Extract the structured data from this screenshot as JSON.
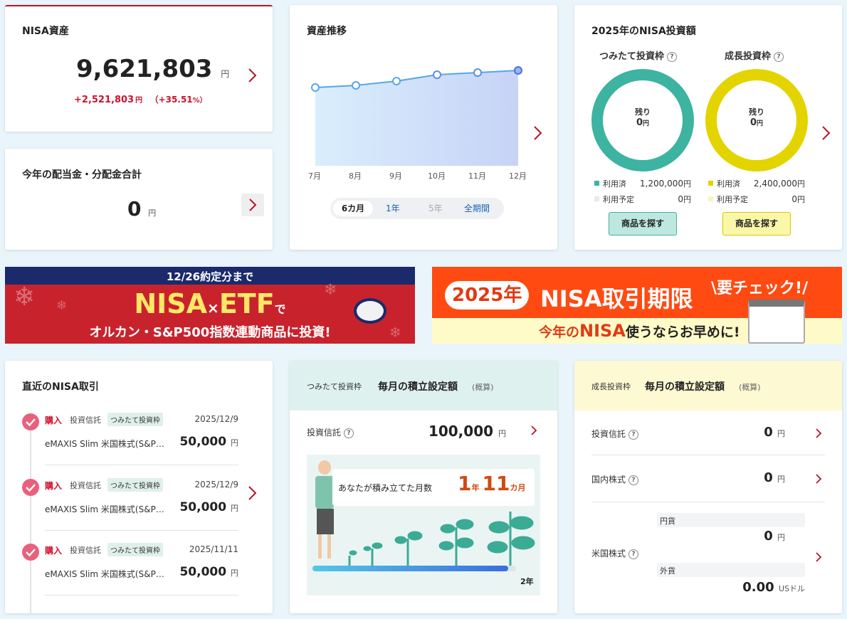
{
  "assets": {
    "title": "NISA資産",
    "value": "9,621,803",
    "unit": "円",
    "gain": "+2,521,803",
    "gain_unit": "円",
    "pct": "（+35.51",
    "pct_unit": "%）"
  },
  "dividend": {
    "title": "今年の配当金・分配金合計",
    "value": "0",
    "unit": "円"
  },
  "trend": {
    "title": "資産推移",
    "months": [
      "7月",
      "8月",
      "9月",
      "10月",
      "11月",
      "12月"
    ],
    "ranges": [
      "6カ月",
      "1年",
      "5年",
      "全期間"
    ]
  },
  "invest2025": {
    "title": "2025年のNISA投資額",
    "tsumitate": {
      "label": "つみたて投資枠",
      "remain_label": "残り",
      "remain": "0",
      "remain_unit": "円",
      "used_label": "利用済",
      "used": "1,200,000",
      "used_unit": "円",
      "plan_label": "利用予定",
      "plan": "0",
      "plan_unit": "円",
      "btn": "商品を探す",
      "color": "#3db3a1"
    },
    "growth": {
      "label": "成長投資枠",
      "remain_label": "残り",
      "remain": "0",
      "remain_unit": "円",
      "used_label": "利用済",
      "used": "2,400,000",
      "used_unit": "円",
      "plan_label": "利用予定",
      "plan": "0",
      "plan_unit": "円",
      "btn": "商品を探す",
      "color": "#e3d400"
    }
  },
  "banner1": {
    "top": "12/26約定分まで",
    "main1": "NISA",
    "cross": "×",
    "main2": "ETF",
    "de": "で",
    "bottom": "オルカン・S&P500指数連動商品に投資!"
  },
  "banner2": {
    "year": "2025年",
    "main": "NISA取引期限",
    "check": "\\要チェック!/",
    "bottom_a": "今年の",
    "bottom_b": "NISA",
    "bottom_c": "使うならお早めに!"
  },
  "recent": {
    "title": "直近のNISA取引",
    "items": [
      {
        "type": "購入",
        "kind": "投資信託",
        "tag": "つみたて投資枠",
        "date": "2025/12/9",
        "name": "eMAXIS Slim 米国株式(S&P…",
        "amount": "50,000",
        "unit": "円"
      },
      {
        "type": "購入",
        "kind": "投資信託",
        "tag": "つみたて投資枠",
        "date": "2025/12/9",
        "name": "eMAXIS Slim 米国株式(S&P…",
        "amount": "50,000",
        "unit": "円"
      },
      {
        "type": "購入",
        "kind": "投資信託",
        "tag": "つみたて投資枠",
        "date": "2025/11/11",
        "name": "eMAXIS Slim 米国株式(S&P…",
        "amount": "50,000",
        "unit": "円"
      }
    ]
  },
  "tsumi_monthly": {
    "tag": "つみたて投資枠",
    "title": "毎月の積立設定額",
    "approx": "(概算)",
    "row_label": "投資信託",
    "row_value": "100,000",
    "row_unit": "円",
    "months_label": "あなたが積み立てた月数",
    "years": "1",
    "years_unit": "年",
    "months": "11",
    "months_unit": "カ月",
    "bar_end": "2年",
    "progress": 0.96
  },
  "growth_monthly": {
    "tag": "成長投資枠",
    "title": "毎月の積立設定額",
    "approx": "(概算)",
    "rows": [
      {
        "label": "投資信託",
        "value": "0",
        "unit": "円"
      },
      {
        "label": "国内株式",
        "value": "0",
        "unit": "円"
      }
    ],
    "us": {
      "label": "米国株式",
      "yen_label": "円貨",
      "yen": "0",
      "yen_unit": "円",
      "fx_label": "外貨",
      "fx": "0.00",
      "fx_unit": "USドル"
    }
  }
}
